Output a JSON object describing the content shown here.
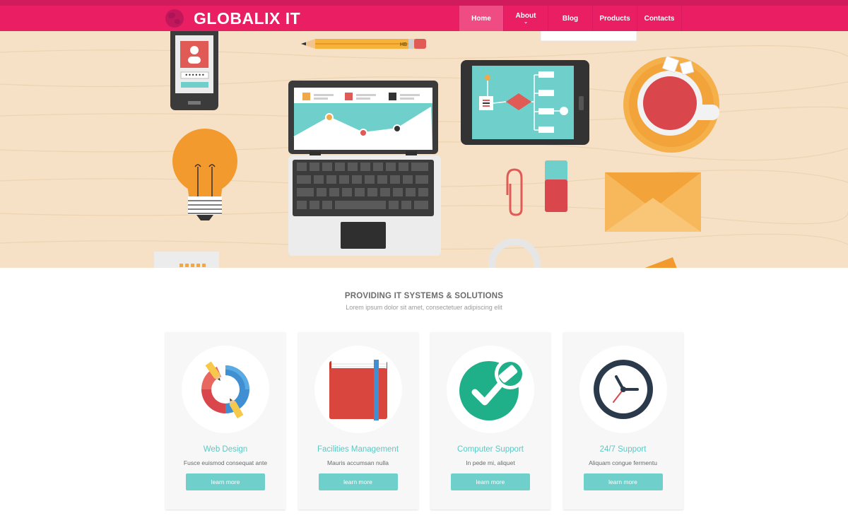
{
  "brand": {
    "name": "GLOBALIX IT",
    "logo_icon": "globe-icon"
  },
  "nav": {
    "items": [
      {
        "label": "Home",
        "active": true
      },
      {
        "label": "About",
        "has_dropdown": true
      },
      {
        "label": "Blog"
      },
      {
        "label": "Products"
      },
      {
        "label": "Contacts"
      }
    ]
  },
  "hero": {
    "illustration": "flat-desk-illustration",
    "pencil_label": "HB"
  },
  "intro": {
    "title": "PROVIDING IT SYSTEMS & SOLUTIONS",
    "subtitle": "Lorem ipsum dolor sit amet, consectetuer adipiscing elit"
  },
  "services": [
    {
      "title": "Web Design",
      "text": "Fusce euismod consequat ante",
      "button": "learn more",
      "icon": "ring-chart-pencils-icon"
    },
    {
      "title": "Facilities Management",
      "text": "Mauris accumsan nulla",
      "button": "learn more",
      "icon": "book-icon"
    },
    {
      "title": "Computer Support",
      "text": "In pede mi, aliquet",
      "button": "learn more",
      "icon": "checkmark-icon"
    },
    {
      "title": "24/7 Support",
      "text": "Aliquam congue fermentu",
      "button": "learn more",
      "icon": "clock-icon"
    }
  ],
  "colors": {
    "header": "#e91e63",
    "header_strip": "#d01c5c",
    "accent": "#6fd0cb",
    "service_title": "#5cc8c4",
    "hero_bg": "#f6e1c6"
  }
}
